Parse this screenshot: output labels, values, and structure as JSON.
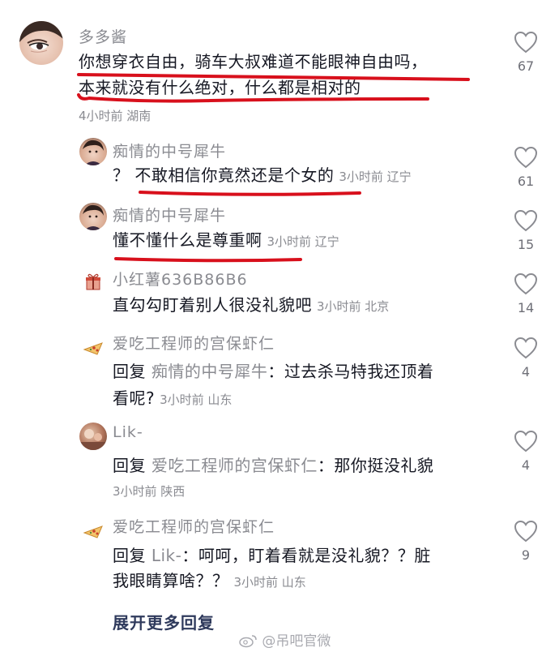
{
  "comments": [
    {
      "username": "多多酱",
      "text_line1": "你想穿衣自由，骑车大叔难道不能眼神自由吗，",
      "text_line2": "本来就没有什么绝对，什么都是相对的",
      "meta": "4小时前 湖南",
      "likes": "67"
    }
  ],
  "replies": [
    {
      "username": "痴情的中号犀牛",
      "text": "？ 不敢相信你竟然还是个女的",
      "meta": "3小时前 辽宁",
      "likes": "61"
    },
    {
      "username": "痴情的中号犀牛",
      "text": "懂不懂什么是尊重啊",
      "meta": "3小时前 辽宁",
      "likes": "15"
    },
    {
      "username": "小红薯636B86B6",
      "text": "直勾勾盯着别人很没礼貌吧",
      "meta": "3小时前 北京",
      "likes": "14"
    },
    {
      "username": "爱吃工程师的宫保虾仁",
      "reply_prefix": "回复",
      "reply_to": "痴情的中号犀牛",
      "text_line1": "：过去杀马特我还顶着",
      "text_line2": "看呢?",
      "meta": "3小时前 山东",
      "likes": "4"
    },
    {
      "username": "Lik-",
      "reply_prefix": "回复",
      "reply_to": "爱吃工程师的宫保虾仁",
      "text_line1": "：那你挺没礼貌",
      "meta": "3小时前 陕西",
      "likes": "4"
    },
    {
      "username": "爱吃工程师的宫保虾仁",
      "reply_prefix": "回复",
      "reply_to": "Lik-",
      "text_line1": "：呵呵，盯着看就是没礼貌？？脏",
      "text_line2": "我眼睛算啥？？",
      "meta": "3小时前 山东",
      "likes": "9"
    }
  ],
  "expand_more": "展开更多回复",
  "watermark": "@吊吧官微",
  "colors": {
    "highlight_underline": "#d8101c",
    "secondary_text": "#8a8b91",
    "expand_link": "#2f3a5c"
  }
}
